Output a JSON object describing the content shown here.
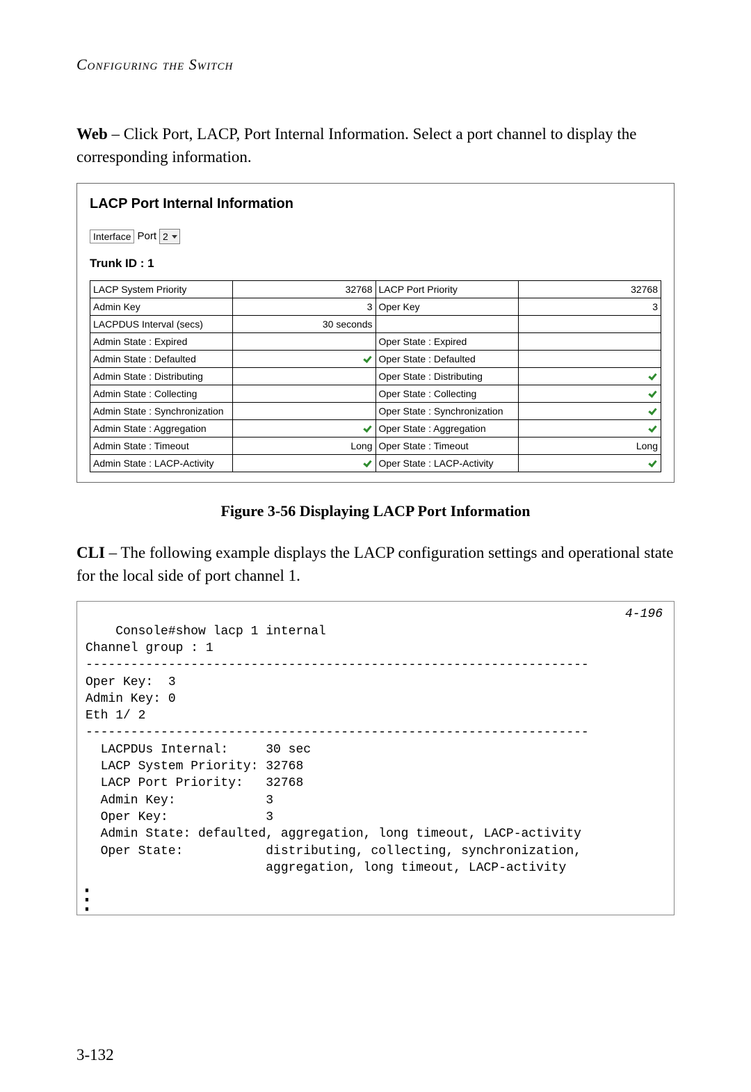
{
  "running_head": "Configuring the Switch",
  "web_intro_prefix": "Web",
  "web_intro_rest": " – Click Port, LACP, Port Internal Information. Select a port channel to display the corresponding information.",
  "panel": {
    "title": "LACP Port Internal Information",
    "interface_label": "Interface",
    "port_label": "Port",
    "port_value": "2",
    "trunk_label": "Trunk ID : 1",
    "rows": {
      "r1": {
        "l1": "LACP System Priority",
        "v1": "32768",
        "l2": "LACP Port Priority",
        "v2": "32768"
      },
      "r2": {
        "l1": "Admin Key",
        "v1": "3",
        "l2": "Oper Key",
        "v2": "3"
      },
      "r3": {
        "l1": "LACPDUS Interval (secs)",
        "v1": "30 seconds",
        "l2": "",
        "v2": ""
      },
      "r4": {
        "l1": "Admin State : Expired",
        "v1": "",
        "l2": "Oper State : Expired",
        "v2": ""
      },
      "r5": {
        "l1": "Admin State : Defaulted",
        "v1": "check",
        "l2": "Oper State : Defaulted",
        "v2": ""
      },
      "r6": {
        "l1": "Admin State : Distributing",
        "v1": "",
        "l2": "Oper State : Distributing",
        "v2": "check"
      },
      "r7": {
        "l1": "Admin State : Collecting",
        "v1": "",
        "l2": "Oper State : Collecting",
        "v2": "check"
      },
      "r8": {
        "l1": "Admin State : Synchronization",
        "v1": "",
        "l2": "Oper State : Synchronization",
        "v2": "check"
      },
      "r9": {
        "l1": "Admin State : Aggregation",
        "v1": "check",
        "l2": "Oper State : Aggregation",
        "v2": "check"
      },
      "r10": {
        "l1": "Admin State : Timeout",
        "v1": "Long",
        "l2": "Oper State : Timeout",
        "v2": "Long"
      },
      "r11": {
        "l1": "Admin State : LACP-Activity",
        "v1": "check",
        "l2": "Oper State : LACP-Activity",
        "v2": "check"
      }
    }
  },
  "figure_caption": "Figure 3-56   Displaying LACP Port Information",
  "cli_intro_prefix": "CLI",
  "cli_intro_rest": " – The following example displays the LACP configuration settings and operational state for the local side of port channel 1.",
  "cli_page_ref": "4-196",
  "cli_text": "Console#show lacp 1 internal\nChannel group : 1\n-------------------------------------------------------------------\nOper Key:  3\nAdmin Key: 0\nEth 1/ 2\n-------------------------------------------------------------------\n  LACPDUs Internal:     30 sec\n  LACP System Priority: 32768\n  LACP Port Priority:   32768\n  Admin Key:            3\n  Oper Key:             3\n  Admin State: defaulted, aggregation, long timeout, LACP-activity\n  Oper State:           distributing, collecting, synchronization,\n                        aggregation, long timeout, LACP-activity",
  "page_number": "3-132"
}
